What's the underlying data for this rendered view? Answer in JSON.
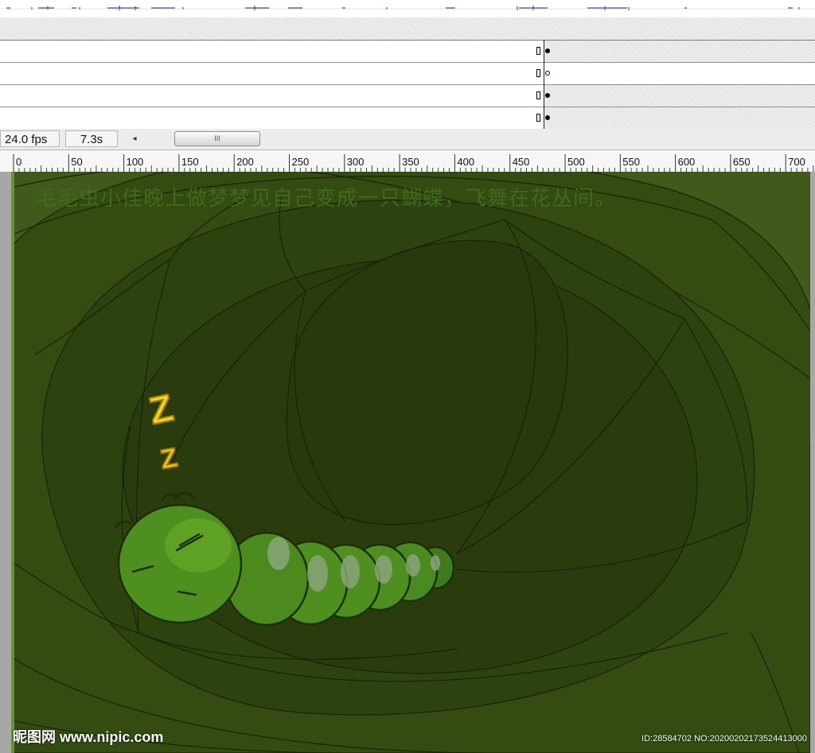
{
  "timeline": {
    "layers": [
      {
        "start_marker": "empty-box",
        "keyframe": "filled"
      },
      {
        "start_marker": "empty-box",
        "keyframe": "hollow"
      },
      {
        "start_marker": "empty-box",
        "keyframe": "filled"
      },
      {
        "start_marker": "empty-box",
        "keyframe": "filled"
      }
    ],
    "status": {
      "fps": "24.0 fps",
      "time": "7.3s",
      "scroll_left_glyph": "◂",
      "scroll_thumb_glyph": "III"
    }
  },
  "ruler": {
    "labels": [
      "0",
      "50",
      "100",
      "150",
      "200",
      "250",
      "300",
      "350",
      "400",
      "450",
      "500",
      "550",
      "600",
      "650",
      "700"
    ]
  },
  "stage": {
    "caption": "毛毛虫小佳晚上做梦梦见自己变成一只蝴蝶，飞舞在花丛间。",
    "sleep_letters": [
      "Z",
      "Z"
    ],
    "background_color": "#3f5a15",
    "caterpillar_color": "#4f8f1f"
  },
  "watermark": {
    "site": "昵图网 www.nipic.com",
    "id_text": "ID:28584702 NO:20200202173524413000"
  }
}
